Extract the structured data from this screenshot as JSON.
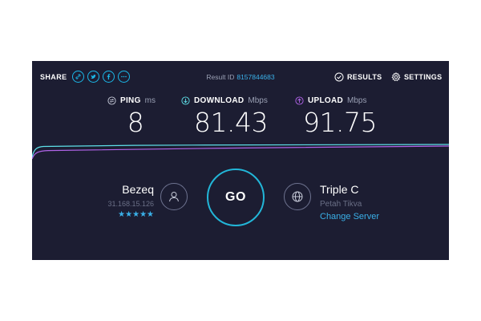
{
  "topbar": {
    "share_label": "SHARE",
    "result_id_label": "Result ID",
    "result_id": "8157844683",
    "results_label": "RESULTS",
    "settings_label": "SETTINGS"
  },
  "metrics": {
    "ping": {
      "label": "PING",
      "unit": "ms",
      "value": "8"
    },
    "download": {
      "label": "DOWNLOAD",
      "unit": "Mbps",
      "value": "81.43"
    },
    "upload": {
      "label": "UPLOAD",
      "unit": "Mbps",
      "value": "91.75"
    }
  },
  "isp": {
    "name": "Bezeq",
    "ip": "31.168.15.126",
    "stars": "★★★★★"
  },
  "go_label": "GO",
  "server": {
    "name": "Triple C",
    "location": "Petah Tikva",
    "change_label": "Change Server"
  },
  "colors": {
    "background": "#1c1d32",
    "accent_cyan": "#1bb8e8",
    "download_line": "#5ee0e8",
    "upload_line": "#b064e8",
    "link": "#3ab0e8"
  }
}
